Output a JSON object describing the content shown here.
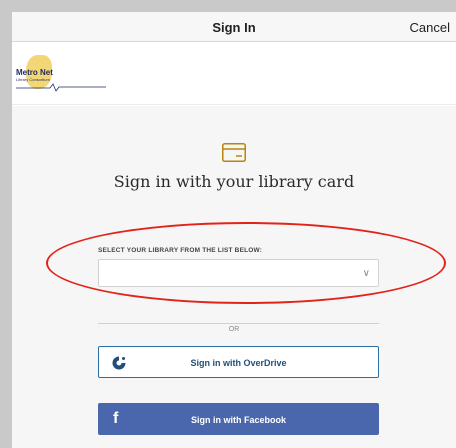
{
  "topbar": {
    "title": "Sign In",
    "cancel_label": "Cancel"
  },
  "logo": {
    "name": "Metro Net",
    "subtitle": "Library Consortium"
  },
  "main": {
    "heading": "Sign in with your library card",
    "card_icon": "credit-card-icon",
    "select_label": "SELECT YOUR LIBRARY FROM THE LIST BELOW:",
    "select_value": "",
    "divider_text": "OR",
    "overdrive_button": "Sign in with OverDrive",
    "overdrive_icon": "overdrive-icon",
    "facebook_button": "Sign in with Facebook",
    "facebook_icon_glyph": "f"
  },
  "colors": {
    "highlight": "#e2231a",
    "facebook": "#4a67ad",
    "overdrive_border": "#2b6ea3",
    "card_icon": "#b8860b"
  }
}
